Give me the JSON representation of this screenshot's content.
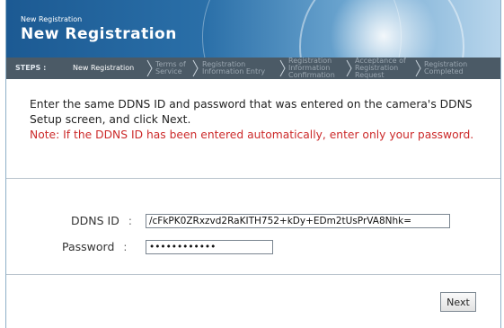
{
  "header": {
    "small_title": "New Registration",
    "title": "New Registration"
  },
  "steps": {
    "label": "STEPS :",
    "items": [
      {
        "label": "New Registration",
        "state": "current"
      },
      {
        "label": "Terms of\nService",
        "state": "upcoming"
      },
      {
        "label": "Registration\nInformation Entry",
        "state": "upcoming"
      },
      {
        "label": "Registration\nInformation\nConfirmation",
        "state": "upcoming"
      },
      {
        "label": "Acceptance of\nRegistration\nRequest",
        "state": "upcoming"
      },
      {
        "label": "Registration\nCompleted",
        "state": "upcoming"
      }
    ]
  },
  "instructions": {
    "main": "Enter the same DDNS ID and password that was entered on the camera's DDNS Setup screen, and click Next.",
    "note": "Note: If the DDNS ID has been entered automatically, enter only your password."
  },
  "form": {
    "ddns_label": "DDNS ID",
    "ddns_value": "/cFkPK0ZRxzvd2RaKITH752+kDy+EDm2tUsPrVA8Nhk=",
    "password_label": "Password",
    "password_value": "xxxxxxxxxxxx",
    "colon": ":"
  },
  "actions": {
    "next_label": "Next"
  },
  "colors": {
    "header_blue": "#1c5a93",
    "steps_bar": "#4b5a66",
    "note_red": "#cc2a2a"
  }
}
